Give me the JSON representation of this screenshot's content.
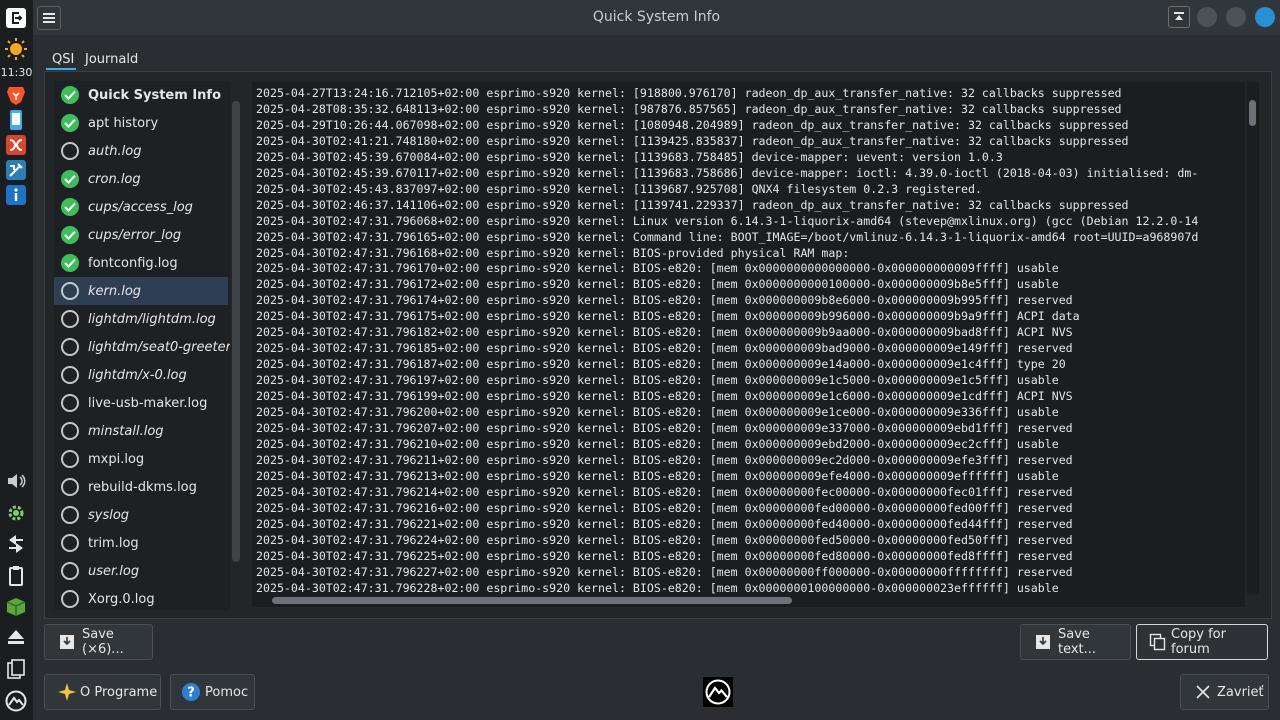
{
  "window": {
    "title": "Quick System Info"
  },
  "taskbar": {
    "clock": "11:30",
    "icons": [
      "whisker-menu-icon",
      "weather-sun-icon",
      "brave-browser-icon",
      "phone-icon",
      "mx-conky-icon",
      "mx-tools-icon",
      "info-icon",
      "volume-icon",
      "settings-gear-icon",
      "network-arrows-icon",
      "clipboard-icon",
      "packages-box-icon",
      "eject-icon",
      "documents-icon",
      "mx-logo-icon"
    ]
  },
  "tabs": [
    {
      "label": "QSI"
    },
    {
      "label": "Journald"
    }
  ],
  "file_list": [
    {
      "label": "Quick System Info",
      "status": "ok"
    },
    {
      "label": "apt history",
      "status": "ok"
    },
    {
      "label": "auth.log",
      "status": "none"
    },
    {
      "label": "cron.log",
      "status": "ok"
    },
    {
      "label": "cups/access_log",
      "status": "ok"
    },
    {
      "label": "cups/error_log",
      "status": "ok"
    },
    {
      "label": "fontconfig.log",
      "status": "ok"
    },
    {
      "label": "kern.log",
      "status": "none"
    },
    {
      "label": "lightdm/lightdm.log",
      "status": "none"
    },
    {
      "label": "lightdm/seat0-greeter.log",
      "status": "none"
    },
    {
      "label": "lightdm/x-0.log",
      "status": "none"
    },
    {
      "label": "live-usb-maker.log",
      "status": "none"
    },
    {
      "label": "minstall.log",
      "status": "none"
    },
    {
      "label": "mxpi.log",
      "status": "none"
    },
    {
      "label": "rebuild-dkms.log",
      "status": "none"
    },
    {
      "label": "syslog",
      "status": "none"
    },
    {
      "label": "trim.log",
      "status": "none"
    },
    {
      "label": "user.log",
      "status": "none"
    },
    {
      "label": "Xorg.0.log",
      "status": "none"
    }
  ],
  "log_lines": [
    "2025-04-27T13:24:16.712105+02:00 esprimo-s920 kernel: [918800.976170] radeon_dp_aux_transfer_native: 32 callbacks suppressed",
    "2025-04-28T08:35:32.648113+02:00 esprimo-s920 kernel: [987876.857565] radeon_dp_aux_transfer_native: 32 callbacks suppressed",
    "2025-04-29T10:26:44.067098+02:00 esprimo-s920 kernel: [1080948.204989] radeon_dp_aux_transfer_native: 32 callbacks suppressed",
    "2025-04-30T02:41:21.748180+02:00 esprimo-s920 kernel: [1139425.835837] radeon_dp_aux_transfer_native: 32 callbacks suppressed",
    "2025-04-30T02:45:39.670084+02:00 esprimo-s920 kernel: [1139683.758485] device-mapper: uevent: version 1.0.3",
    "2025-04-30T02:45:39.670117+02:00 esprimo-s920 kernel: [1139683.758686] device-mapper: ioctl: 4.39.0-ioctl (2018-04-03) initialised: dm-",
    "2025-04-30T02:45:43.837097+02:00 esprimo-s920 kernel: [1139687.925708] QNX4 filesystem 0.2.3 registered.",
    "2025-04-30T02:46:37.141106+02:00 esprimo-s920 kernel: [1139741.229337] radeon_dp_aux_transfer_native: 32 callbacks suppressed",
    "2025-04-30T02:47:31.796068+02:00 esprimo-s920 kernel: Linux version 6.14.3-1-liquorix-amd64 (stevep@mxlinux.org) (gcc (Debian 12.2.0-14",
    "2025-04-30T02:47:31.796165+02:00 esprimo-s920 kernel: Command line: BOOT_IMAGE=/boot/vmlinuz-6.14.3-1-liquorix-amd64 root=UUID=a968907d",
    "2025-04-30T02:47:31.796168+02:00 esprimo-s920 kernel: BIOS-provided physical RAM map:",
    "2025-04-30T02:47:31.796170+02:00 esprimo-s920 kernel: BIOS-e820: [mem 0x0000000000000000-0x000000000009ffff] usable",
    "2025-04-30T02:47:31.796172+02:00 esprimo-s920 kernel: BIOS-e820: [mem 0x0000000000100000-0x000000009b8e5fff] usable",
    "2025-04-30T02:47:31.796174+02:00 esprimo-s920 kernel: BIOS-e820: [mem 0x000000009b8e6000-0x000000009b995fff] reserved",
    "2025-04-30T02:47:31.796175+02:00 esprimo-s920 kernel: BIOS-e820: [mem 0x000000009b996000-0x000000009b9a9fff] ACPI data",
    "2025-04-30T02:47:31.796182+02:00 esprimo-s920 kernel: BIOS-e820: [mem 0x000000009b9aa000-0x000000009bad8fff] ACPI NVS",
    "2025-04-30T02:47:31.796185+02:00 esprimo-s920 kernel: BIOS-e820: [mem 0x000000009bad9000-0x000000009e149fff] reserved",
    "2025-04-30T02:47:31.796187+02:00 esprimo-s920 kernel: BIOS-e820: [mem 0x000000009e14a000-0x000000009e1c4fff] type 20",
    "2025-04-30T02:47:31.796197+02:00 esprimo-s920 kernel: BIOS-e820: [mem 0x000000009e1c5000-0x000000009e1c5fff] usable",
    "2025-04-30T02:47:31.796199+02:00 esprimo-s920 kernel: BIOS-e820: [mem 0x000000009e1c6000-0x000000009e1cdfff] ACPI NVS",
    "2025-04-30T02:47:31.796200+02:00 esprimo-s920 kernel: BIOS-e820: [mem 0x000000009e1ce000-0x000000009e336fff] usable",
    "2025-04-30T02:47:31.796207+02:00 esprimo-s920 kernel: BIOS-e820: [mem 0x000000009e337000-0x000000009ebd1fff] reserved",
    "2025-04-30T02:47:31.796210+02:00 esprimo-s920 kernel: BIOS-e820: [mem 0x000000009ebd2000-0x000000009ec2cfff] usable",
    "2025-04-30T02:47:31.796211+02:00 esprimo-s920 kernel: BIOS-e820: [mem 0x000000009ec2d000-0x000000009efe3fff] reserved",
    "2025-04-30T02:47:31.796213+02:00 esprimo-s920 kernel: BIOS-e820: [mem 0x000000009efe4000-0x000000009effffff] usable",
    "2025-04-30T02:47:31.796214+02:00 esprimo-s920 kernel: BIOS-e820: [mem 0x00000000fec00000-0x00000000fec01fff] reserved",
    "2025-04-30T02:47:31.796216+02:00 esprimo-s920 kernel: BIOS-e820: [mem 0x00000000fed00000-0x00000000fed00fff] reserved",
    "2025-04-30T02:47:31.796221+02:00 esprimo-s920 kernel: BIOS-e820: [mem 0x00000000fed40000-0x00000000fed44fff] reserved",
    "2025-04-30T02:47:31.796224+02:00 esprimo-s920 kernel: BIOS-e820: [mem 0x00000000fed50000-0x00000000fed50fff] reserved",
    "2025-04-30T02:47:31.796225+02:00 esprimo-s920 kernel: BIOS-e820: [mem 0x00000000fed80000-0x00000000fed8ffff] reserved",
    "2025-04-30T02:47:31.796227+02:00 esprimo-s920 kernel: BIOS-e820: [mem 0x00000000ff000000-0x00000000ffffffff] reserved",
    "2025-04-30T02:47:31.796228+02:00 esprimo-s920 kernel: BIOS-e820: [mem 0x0000000100000000-0x000000023effffff] usable"
  ],
  "buttons": {
    "save": "Save (×6)...",
    "save_text": "Save text...",
    "copy_forum": "Copy for forum",
    "about": "O Programe",
    "help": "Pomoc",
    "close": "Zavrieť"
  },
  "colors": {
    "accent": "#3daee9",
    "ok_green": "#3ebd5d",
    "selection": "#2e3f53"
  }
}
